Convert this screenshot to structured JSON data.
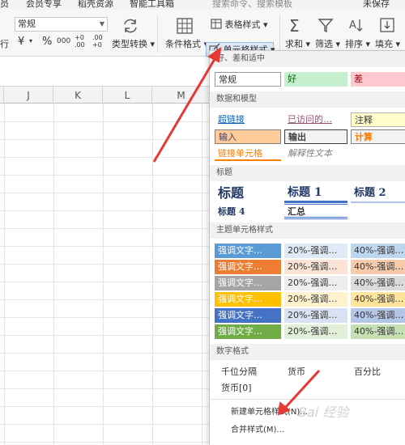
{
  "menubar": {
    "items": [
      "员",
      "会员专享",
      "稻壳资源",
      "智能工具箱",
      "搜索命令、搜索模板",
      "未保存"
    ]
  },
  "ribbon": {
    "number_format_value": "常规",
    "row1_left": "行",
    "currency_symbol": "¥",
    "percent_symbol": "%",
    "thousands_symbol": "000",
    "inc_decimal": "+0 .00",
    "dec_decimal": ".00 +0",
    "type_convert_label": "类型转换",
    "cond_format_label": "条件格式",
    "table_style_label": "表格样式",
    "cell_style_label": "单元格样式",
    "sum_label": "求和",
    "filter_label": "筛选",
    "sort_label": "排序",
    "fill_label": "填充"
  },
  "sheet": {
    "columns": [
      "J",
      "K",
      "L",
      "M"
    ]
  },
  "panel": {
    "section_good_bad": "好、差和适中",
    "normal": "常规",
    "good": "好",
    "bad": "差",
    "section_data_model": "数据和模型",
    "hyperlink": "超链接",
    "visited": "已访问的…",
    "note": "注释",
    "input": "输入",
    "output": "输出",
    "calc": "计算",
    "linked_cell": "链接单元格",
    "explanatory": "解释性文本",
    "section_title": "标题",
    "title": "标题",
    "title1": "标题 1",
    "title2": "标题 2",
    "title4": "标题 4",
    "total": "汇总",
    "section_theme": "主题单元格样式",
    "accent_label": "强调文字…",
    "pct20_label": "20%-强调…",
    "pct40_label": "40%-强调…",
    "accent_colors": [
      "#5b9bd5",
      "#ed7d31",
      "#a5a5a5",
      "#ffc000",
      "#4472c4",
      "#70ad47"
    ],
    "pct20_colors": [
      "#deeaf6",
      "#fbe4d5",
      "#ededed",
      "#fff2cc",
      "#d9e2f3",
      "#e2efd9"
    ],
    "pct40_colors": [
      "#bdd7ee",
      "#f7caac",
      "#dbdbdb",
      "#ffe599",
      "#b4c6e7",
      "#c5e0b3"
    ],
    "section_number": "数字格式",
    "thousands": "千位分隔",
    "currency": "货币",
    "percent": "百分比",
    "currency0": "货币[0]",
    "new_style": "新建单元格样式(N)...",
    "merge_style": "合并样式(M)..."
  },
  "watermark": "Bai 经验"
}
